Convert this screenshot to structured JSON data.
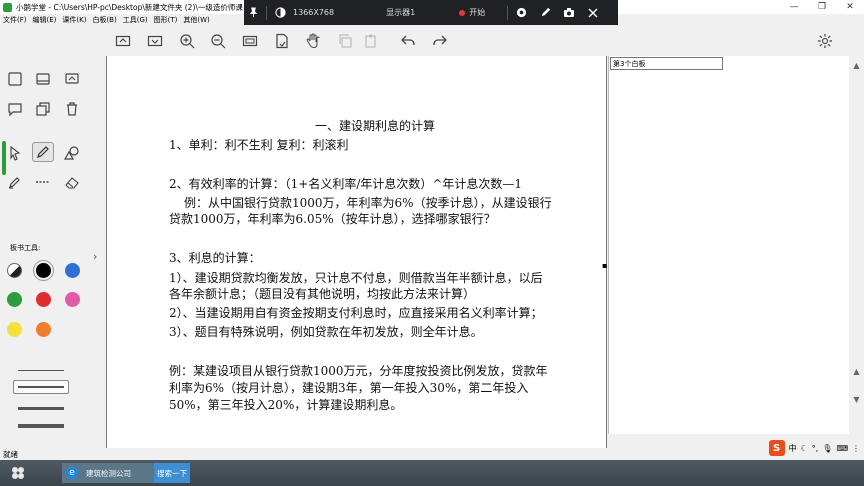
{
  "window": {
    "title": "小鹅学堂 - C:\\Users\\HP-pc\\Desktop\\新建文件夹 (2)\\一级造价师课",
    "controls": [
      "—",
      "❐",
      "✕"
    ]
  },
  "menu": [
    "文件(F)",
    "编辑(E)",
    "课件(K)",
    "白板(B)",
    "工具(G)",
    "图形(T)",
    "其他(W)"
  ],
  "sharebar": {
    "resolution": "1366X768",
    "display": "显示器1",
    "start": "开始"
  },
  "toolbar_icons": [
    "rectangle-icon",
    "dropdown-box-icon",
    "zoom-in-icon",
    "zoom-out-icon",
    "fit-screen-icon",
    "page-icon",
    "hand-icon",
    "copy-icon",
    "paste-icon",
    "undo-icon",
    "redo-icon"
  ],
  "board_tools_label": "板书工具:",
  "colors": [
    "#000000",
    "#2f6fd8",
    "#2e9c3a",
    "#e02e2e",
    "#e05aa8",
    "#f2e03c",
    "#ee7e2e"
  ],
  "right_panel": {
    "board_name": "第3个白板"
  },
  "document": {
    "heading": "一、建设期利息的计算",
    "line1": "1、单利：利不生利  复利：利滚利",
    "line2": "2、有效利率的计算：（1+名义利率/年计息次数）^年计息次数—1",
    "line3": "例：从中国银行贷款1000万，年利率为6%（按季计息），从建设银行",
    "line4": "贷款1000万，年利率为6.05%（按年计息），选择哪家银行？",
    "line5": "3、利息的计算：",
    "line6": "1）、建设期贷款均衡发放，只计息不付息，则借款当年半额计息，以后",
    "line7": "各年余额计息；（题目没有其他说明，均按此方法来计算）",
    "line8": "2）、当建设期用自有资金按期支付利息时，应直接采用名义利率计算；",
    "line9": "3）、题目有特殊说明，例如贷款在年初发放，则全年计息。",
    "line10": "例：某建设项目从银行贷款1000万元，分年度按投资比例发放，贷款年",
    "line11": "利率为6%（按月计息），建设期3年，第一年投入30%，第二年投入",
    "line12": "50%，第三年投入20%，计算建设期利息。"
  },
  "status": "就绪",
  "taskbar": {
    "item": "建筑检测公司",
    "search": "搜索一下"
  },
  "tray": {
    "ime": "中"
  }
}
